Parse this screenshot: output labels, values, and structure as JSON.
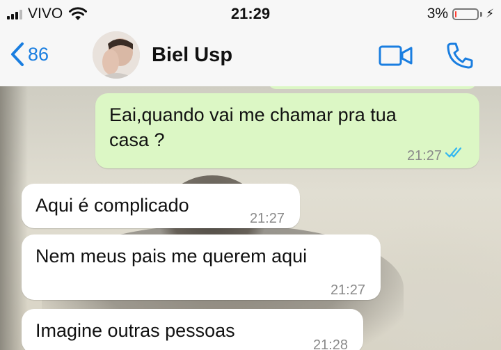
{
  "status": {
    "carrier": "VIVO",
    "time": "21:29",
    "battery": "3%",
    "battery_level": 0.03
  },
  "nav": {
    "back_count": "86",
    "contact_name": "Biel Usp"
  },
  "messages": [
    {
      "direction": "out",
      "text_lines": [
        "Eai,quando vai me chamar pra tua",
        "casa ?"
      ],
      "time": "21:27",
      "status": "read"
    },
    {
      "direction": "in",
      "text_lines": [
        "Aqui é complicado"
      ],
      "time": "21:27"
    },
    {
      "direction": "in",
      "text_lines": [
        "Nem meus pais me querem aqui"
      ],
      "time": "21:27"
    },
    {
      "direction": "in",
      "text_lines": [
        "Imagine outras pessoas"
      ],
      "time": "21:28"
    }
  ],
  "colors": {
    "accent": "#1a7ee0",
    "outgoing_bubble": "#dcf7c5",
    "incoming_bubble": "#ffffff",
    "read_ticks": "#34b7f1"
  },
  "icons": {
    "back": "chevron-left-icon",
    "video": "video-camera-icon",
    "call": "phone-icon",
    "signal": "signal-bars-icon",
    "wifi": "wifi-icon",
    "charging": "bolt-icon"
  }
}
